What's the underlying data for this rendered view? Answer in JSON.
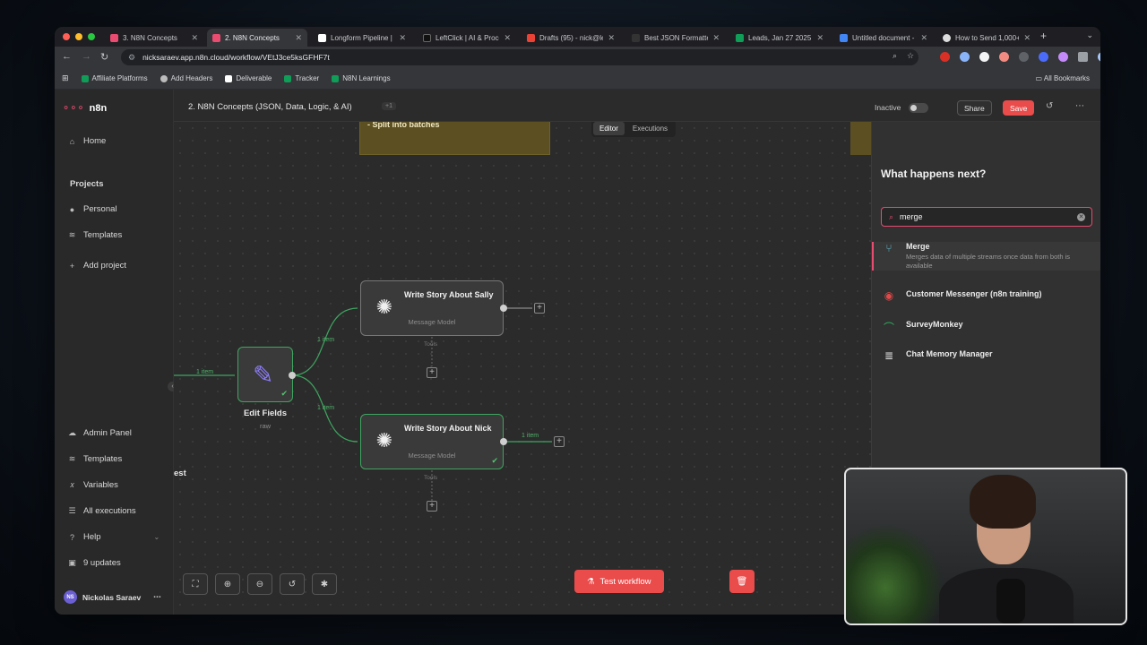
{
  "browser": {
    "tabs": [
      {
        "title": "3. N8N Concepts",
        "favicon_color": "#ea4b71"
      },
      {
        "title": "2. N8N Concepts",
        "favicon_color": "#ea4b71",
        "active": true
      },
      {
        "title": "Longform Pipeline | N",
        "favicon_color": "#ffffff"
      },
      {
        "title": "LeftClick | AI & Proce",
        "favicon_color": "#111111"
      },
      {
        "title": "Drafts (95) - nick@le",
        "favicon_color": "#ea4335"
      },
      {
        "title": "Best JSON Formatter",
        "favicon_color": "#333333"
      },
      {
        "title": "Leads, Jan 27 2025",
        "favicon_color": "#0f9d58"
      },
      {
        "title": "Untitled document -",
        "favicon_color": "#4285f4"
      },
      {
        "title": "How to Send 1,000+",
        "favicon_color": "#dddddd"
      }
    ],
    "url": "nicksaraev.app.n8n.cloud/workflow/VEtJ3ce5ksGFHF7t",
    "bookmarks": [
      "Affiliate Platforms",
      "Add Headers",
      "Deliverable",
      "Tracker",
      "N8N Learnings"
    ],
    "all_bookmarks": "All Bookmarks"
  },
  "sidebar": {
    "brand": "n8n",
    "home": "Home",
    "projects_heading": "Projects",
    "project_items": [
      "Personal",
      "Templates",
      "Add project"
    ],
    "bottom_items": [
      "Admin Panel",
      "Templates",
      "Variables",
      "All executions",
      "Help",
      "9 updates"
    ],
    "user_name": "Nickolas Saraev",
    "user_initials": "NS"
  },
  "header": {
    "workflow_name": "2. N8N Concepts (JSON, Data, Logic, & AI)",
    "tag_count": "+1",
    "status": "Inactive",
    "share": "Share",
    "save": "Save"
  },
  "canvas": {
    "mode_editor": "Editor",
    "mode_executions": "Executions",
    "sticky_text": "- Split into batches",
    "trigger_fragment": "est",
    "edit_node": {
      "name": "Edit Fields",
      "sub": "raw"
    },
    "node_sally": {
      "title": "Write Story About Sally",
      "sub": "Message Model",
      "tools": "Tools"
    },
    "node_nick": {
      "title": "Write Story About Nick",
      "sub": "Message Model",
      "tools": "Tools"
    },
    "edge_labels": {
      "in": "1 item",
      "to_sally": "1 item",
      "to_nick": "1 item",
      "nick_out": "1 item"
    },
    "test_workflow": "Test workflow"
  },
  "panel": {
    "title": "What happens next?",
    "search_value": "merge",
    "results": [
      {
        "title": "Merge",
        "desc": "Merges data of multiple streams once data from both is available",
        "icon": "merge-icon"
      },
      {
        "title": "Customer Messenger (n8n training)",
        "desc": "",
        "icon": "messenger-icon"
      },
      {
        "title": "SurveyMonkey",
        "desc": "",
        "icon": "surveymonkey-icon"
      },
      {
        "title": "Chat Memory Manager",
        "desc": "",
        "icon": "database-icon"
      }
    ]
  },
  "colors": {
    "accent": "#ea4b71",
    "success": "#3ea660",
    "sticky": "#5c5023"
  }
}
